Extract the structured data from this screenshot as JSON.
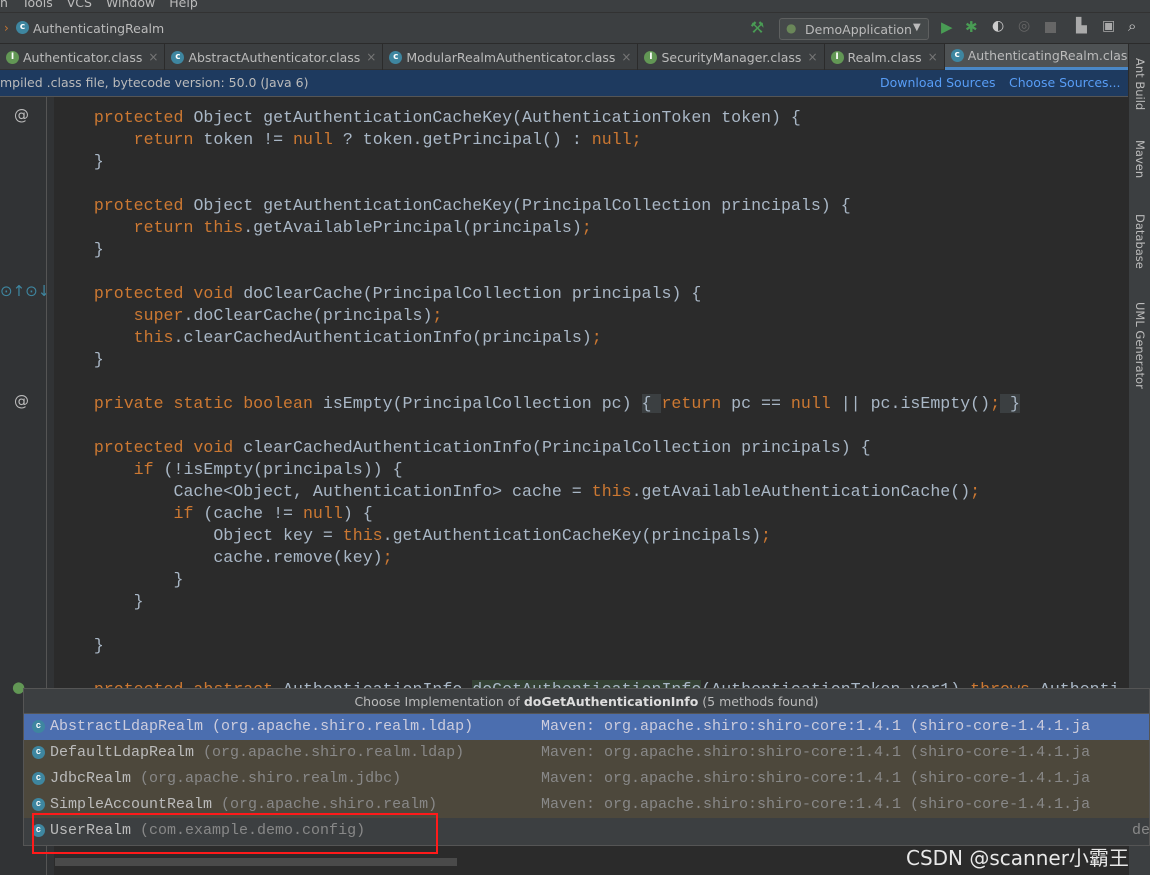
{
  "menu": [
    "n",
    "Tools",
    "VCS",
    "Window",
    "Help"
  ],
  "breadcrumb": {
    "class": "AuthenticatingRealm"
  },
  "run_config": "DemoApplication",
  "tabs": [
    {
      "label": "Authenticator.class",
      "kind": "interface"
    },
    {
      "label": "AbstractAuthenticator.class",
      "kind": "class"
    },
    {
      "label": "ModularRealmAuthenticator.class",
      "kind": "class"
    },
    {
      "label": "SecurityManager.class",
      "kind": "interface"
    },
    {
      "label": "Realm.class",
      "kind": "interface"
    },
    {
      "label": "AuthenticatingRealm.class",
      "kind": "class",
      "active": true
    }
  ],
  "tab_overflow": "4",
  "banner": {
    "text": "mpiled .class file, bytecode version: 50.0 (Java 6)",
    "download": "Download Sources",
    "choose": "Choose Sources..."
  },
  "sidebar": [
    "Ant Build",
    "Maven",
    "Database",
    "UML Generator"
  ],
  "code": [
    [
      [
        "    "
      ],
      [
        "protected ",
        "kw"
      ],
      [
        "Object getAuthenticationCacheKey(AuthenticationToken token) {"
      ]
    ],
    [
      [
        "        "
      ],
      [
        "return ",
        "kw"
      ],
      [
        "token != "
      ],
      [
        "null",
        "kw"
      ],
      [
        " ? token.getPrincipal() : "
      ],
      [
        "null",
        "kw"
      ],
      [
        ";",
        "kw"
      ]
    ],
    [
      [
        "    }"
      ]
    ],
    [
      [
        ""
      ]
    ],
    [
      [
        "    "
      ],
      [
        "protected ",
        "kw"
      ],
      [
        "Object getAuthenticationCacheKey(PrincipalCollection principals) {"
      ]
    ],
    [
      [
        "        "
      ],
      [
        "return this",
        "kw"
      ],
      [
        ".getAvailablePrincipal(principals)"
      ],
      [
        ";",
        "kw"
      ]
    ],
    [
      [
        "    }"
      ]
    ],
    [
      [
        ""
      ]
    ],
    [
      [
        "    "
      ],
      [
        "protected void ",
        "kw"
      ],
      [
        "doClearCache(PrincipalCollection principals) {"
      ]
    ],
    [
      [
        "        "
      ],
      [
        "super",
        "kw"
      ],
      [
        ".doClearCache(principals)"
      ],
      [
        ";",
        "kw"
      ]
    ],
    [
      [
        "        "
      ],
      [
        "this",
        "kw"
      ],
      [
        ".clearCachedAuthenticationInfo(principals)"
      ],
      [
        ";",
        "kw"
      ]
    ],
    [
      [
        "    }"
      ]
    ],
    [
      [
        ""
      ]
    ],
    [
      [
        "    "
      ],
      [
        "private static boolean ",
        "kw"
      ],
      [
        "isEmpty(PrincipalCollection pc) "
      ],
      [
        "{ ",
        "hl"
      ],
      [
        "return ",
        "kw"
      ],
      [
        "pc == "
      ],
      [
        "null ",
        "kw"
      ],
      [
        "|| pc.isEmpty()"
      ],
      [
        ";",
        "kw"
      ],
      [
        " }",
        "hl"
      ]
    ],
    [
      [
        ""
      ]
    ],
    [
      [
        "    "
      ],
      [
        "protected void ",
        "kw"
      ],
      [
        "clearCachedAuthenticationInfo(PrincipalCollection principals) {"
      ]
    ],
    [
      [
        "        "
      ],
      [
        "if ",
        "kw"
      ],
      [
        "(!isEmpty(principals)) {"
      ]
    ],
    [
      [
        "            Cache<Object, AuthenticationInfo> cache = "
      ],
      [
        "this",
        "kw"
      ],
      [
        ".getAvailableAuthenticationCache()"
      ],
      [
        ";",
        "kw"
      ]
    ],
    [
      [
        "            "
      ],
      [
        "if ",
        "kw"
      ],
      [
        "(cache != "
      ],
      [
        "null",
        "kw"
      ],
      [
        ") {"
      ]
    ],
    [
      [
        "                Object key = "
      ],
      [
        "this",
        "kw"
      ],
      [
        ".getAuthenticationCacheKey(principals)"
      ],
      [
        ";",
        "kw"
      ]
    ],
    [
      [
        "                cache.remove(key)"
      ],
      [
        ";",
        "kw"
      ]
    ],
    [
      [
        "            }"
      ]
    ],
    [
      [
        "        }"
      ]
    ],
    [
      [
        ""
      ]
    ],
    [
      [
        "    }"
      ]
    ],
    [
      [
        ""
      ]
    ],
    [
      [
        "    "
      ],
      [
        "protected abstract ",
        "kw"
      ],
      [
        "AuthenticationInfo "
      ],
      [
        "doGetAuthenticationInfo",
        "gr"
      ],
      [
        "(AuthenticationToken var1) "
      ],
      [
        "throws ",
        "kw"
      ],
      [
        "Authenti"
      ]
    ]
  ],
  "popup": {
    "title_prefix": "Choose Implementation of ",
    "method": "doGetAuthenticationInfo",
    "title_suffix": " (5 methods found)",
    "items": [
      {
        "name": "AbstractLdapRealm",
        "package": "(org.apache.shiro.realm.ldap)",
        "source": "Maven: org.apache.shiro:shiro-core:1.4.1 (shiro-core-1.4.1.ja",
        "selected": true
      },
      {
        "name": "DefaultLdapRealm",
        "package": "(org.apache.shiro.realm.ldap)",
        "source": "Maven: org.apache.shiro:shiro-core:1.4.1 (shiro-core-1.4.1.ja"
      },
      {
        "name": "JdbcRealm",
        "package": "(org.apache.shiro.realm.jdbc)",
        "source": "Maven: org.apache.shiro:shiro-core:1.4.1 (shiro-core-1.4.1.ja"
      },
      {
        "name": "SimpleAccountRealm",
        "package": "(org.apache.shiro.realm)",
        "source": "Maven: org.apache.shiro:shiro-core:1.4.1 (shiro-core-1.4.1.ja"
      },
      {
        "name": "UserRealm",
        "package": "(com.example.demo.config)",
        "source": "de",
        "highlighted_box": true
      }
    ]
  },
  "watermark": "CSDN @scanner小霸王",
  "colors": {
    "accent": "#4b6eaf",
    "keyword": "#cc7832",
    "highlight_box": "#ff1a1a"
  }
}
